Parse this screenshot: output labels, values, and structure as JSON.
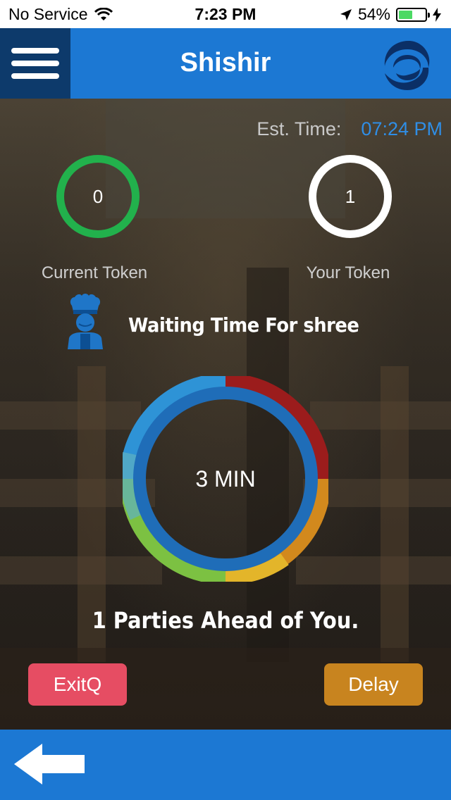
{
  "status_bar": {
    "carrier": "No Service",
    "time": "7:23 PM",
    "battery": "54%",
    "battery_level": 0.54,
    "icons": [
      "wifi-icon",
      "location-arrow-icon",
      "battery-icon",
      "charging-bolt-icon"
    ]
  },
  "header": {
    "title": "Shishir",
    "menu_icon": "hamburger-menu-icon",
    "logo_icon": "swirl-logo-icon"
  },
  "estimate": {
    "label": "Est. Time:",
    "value": "07:24 PM"
  },
  "tokens": {
    "current": {
      "value": "0",
      "label": "Current Token",
      "color": "#22b14c"
    },
    "yours": {
      "value": "1",
      "label": "Your Token",
      "color": "#ffffff"
    }
  },
  "wait": {
    "title": "Waiting Time For shree",
    "icon": "chef-icon",
    "time_text": "3 MIN"
  },
  "queue": {
    "parties_text": "1 Parties Ahead of You."
  },
  "actions": {
    "exit_label": "ExitQ",
    "delay_label": "Delay",
    "exit_color": "#e64d63",
    "delay_color": "#c8841f"
  },
  "bottom_bar": {
    "back_icon": "back-arrow-icon"
  },
  "colors": {
    "brand_blue": "#1c78d3",
    "dark_blue": "#0d3a6b",
    "accent_text": "#2f8ee6"
  }
}
